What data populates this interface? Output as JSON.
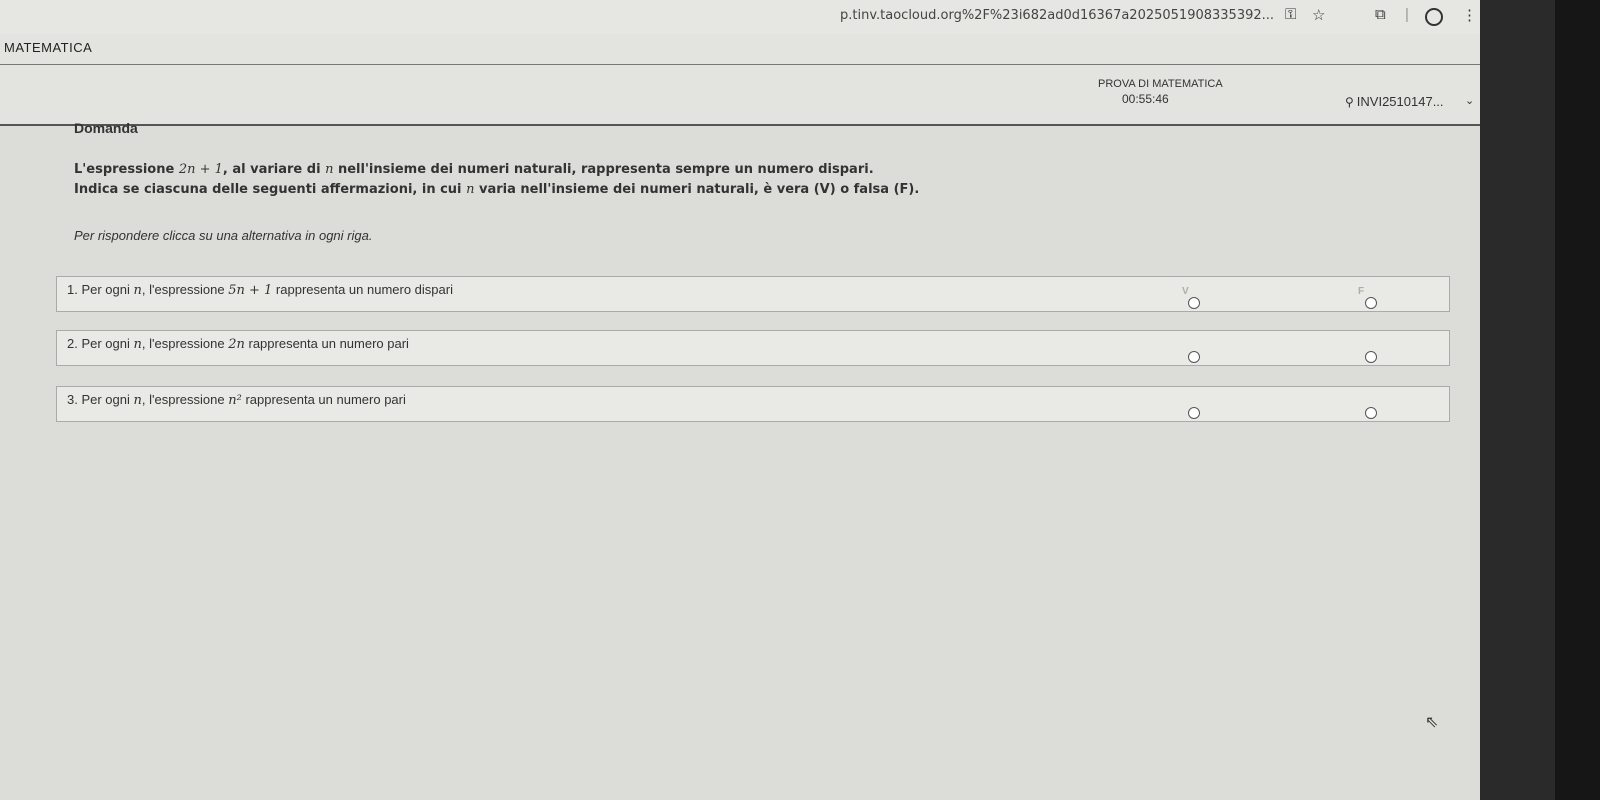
{
  "browser": {
    "url": "p.tinv.taocloud.org%2F%23i682ad0d16367a2025051908335392...",
    "icons": [
      "key-icon",
      "star-icon",
      "extensions-icon",
      "profile-icon",
      "more-vertical-icon"
    ]
  },
  "header": {
    "app_title": "MATEMATICA",
    "exam_title": "PROVA DI MATEMATICA",
    "timer": "00:55:46",
    "user_id": "INVI2510147..."
  },
  "question": {
    "heading": "Domanda",
    "prompt_line1": {
      "pre": "L'espressione",
      "math1": "2n + 1",
      "mid": ", al variare di",
      "math2": "n",
      "post": "nell'insieme dei numeri naturali, rappresenta sempre un numero dispari."
    },
    "prompt_line2": {
      "pre": "Indica se ciascuna delle seguenti affermazioni, in cui",
      "math": "n",
      "post": "varia nell'insieme dei numeri naturali, è vera (V) o falsa (F)."
    },
    "instruction": "Per rispondere clicca su una alternativa in ogni riga.",
    "columns": {
      "true_label": "V",
      "false_label": "F"
    },
    "rows": [
      {
        "number": "1.",
        "pre": "Per ogni",
        "n": "n",
        "mid": ", l'espressione",
        "expr": "5n + 1",
        "post": "rappresenta un numero dispari"
      },
      {
        "number": "2.",
        "pre": "Per ogni",
        "n": "n",
        "mid": ", l'espressione",
        "expr": "2n",
        "post": "rappresenta un numero pari"
      },
      {
        "number": "3.",
        "pre": "Per ogni",
        "n": "n",
        "mid": ", l'espressione",
        "expr": "n²",
        "post": "rappresenta un numero pari"
      }
    ]
  }
}
